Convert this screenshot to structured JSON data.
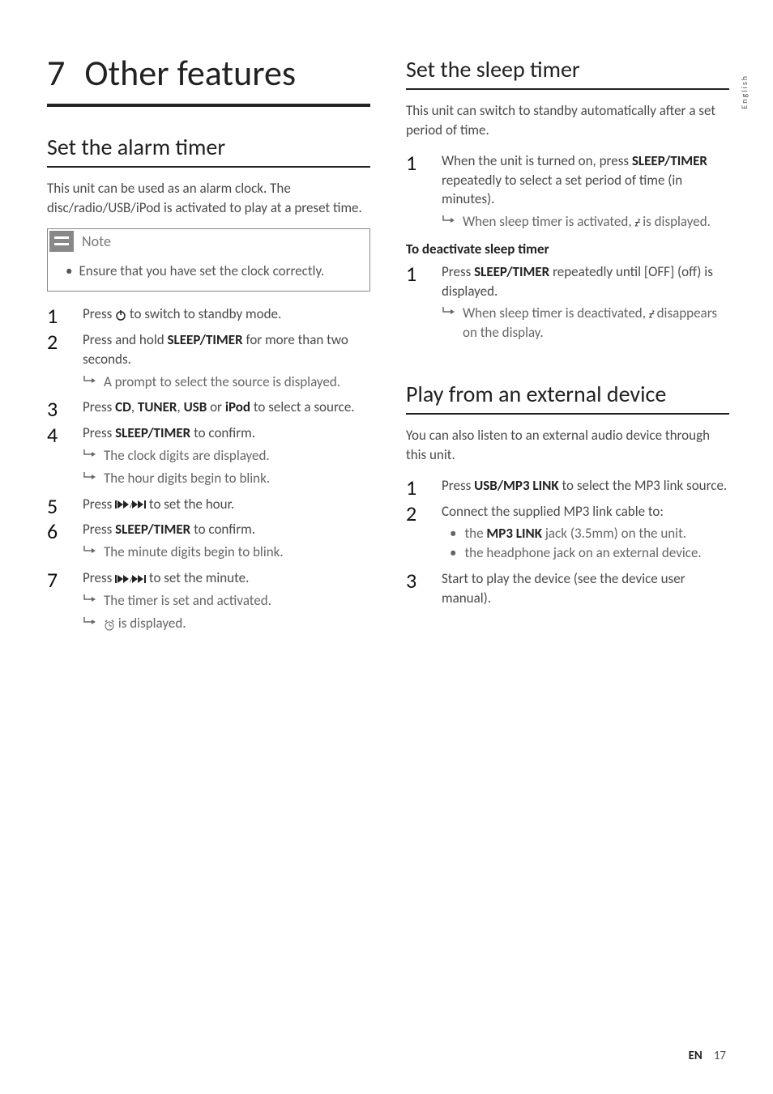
{
  "side_label": "English",
  "chapter": {
    "number": "7",
    "title": "Other features"
  },
  "left": {
    "section1": {
      "heading": "Set the alarm timer",
      "intro": "This unit can be used as an alarm clock. The disc/radio/USB/iPod is activated to play at a preset time.",
      "note_label": "Note",
      "note_text": "Ensure that you have set the clock correctly.",
      "steps": [
        {
          "pre": "Press ",
          "icon": "power",
          "post": " to switch to standby mode."
        },
        {
          "pre": "Press and hold ",
          "bold": "SLEEP/TIMER",
          "post": " for more than two seconds.",
          "subs": [
            "A prompt to select the source is displayed."
          ]
        },
        {
          "pre": "Press ",
          "bold_multi": [
            "CD",
            ", ",
            "TUNER",
            ", ",
            "USB",
            " or ",
            "iPod"
          ],
          "post": " to select a source."
        },
        {
          "pre": "Press ",
          "bold": "SLEEP/TIMER",
          "post": " to confirm.",
          "subs": [
            "The clock digits are displayed.",
            "The hour digits begin to blink."
          ]
        },
        {
          "pre": "Press ",
          "icon": "prevnext",
          "post": " to set the hour."
        },
        {
          "pre": "Press ",
          "bold": "SLEEP/TIMER",
          "post": " to confirm.",
          "subs": [
            "The minute digits begin to blink."
          ]
        },
        {
          "pre": "Press ",
          "icon": "prevnext",
          "post": " to set the minute.",
          "subs": [
            "The timer is set and activated."
          ],
          "subs_icon": [
            " is displayed."
          ]
        }
      ]
    }
  },
  "right": {
    "section1": {
      "heading": "Set the sleep timer",
      "intro": "This unit can switch to standby automatically after a set period of time.",
      "steps": [
        {
          "pre": "When the unit is turned on, press ",
          "bold": "SLEEP/TIMER",
          "post": " repeatedly to select a set period of time (in minutes).",
          "subs_mixed": [
            {
              "pre": "When sleep timer is activated, ",
              "icon": "zz",
              "post": " is displayed."
            }
          ]
        }
      ],
      "sub_heading": "To deactivate sleep timer",
      "steps2": [
        {
          "pre": "Press ",
          "bold": "SLEEP/TIMER",
          "post": " repeatedly until [OFF] (off) is displayed.",
          "subs_mixed": [
            {
              "pre": "When sleep timer is deactivated, ",
              "icon": "zz",
              "post": " disappears on the display."
            }
          ]
        }
      ]
    },
    "section2": {
      "heading": "Play from an external device",
      "intro": "You can also listen to an external audio device through this unit.",
      "steps": [
        {
          "pre": "Press ",
          "bold": "USB/MP3 LINK",
          "post": " to select the MP3 link source."
        },
        {
          "pre": "Connect the supplied MP3 link cable to:",
          "bullets": [
            {
              "pre": "the ",
              "bold": "MP3 LINK",
              "post": " jack (3.5mm) on the unit."
            },
            {
              "pre": "the headphone jack on an external device."
            }
          ]
        },
        {
          "pre": "Start to play the device (see the device user manual)."
        }
      ]
    }
  },
  "footer": {
    "lang": "EN",
    "page": "17"
  }
}
